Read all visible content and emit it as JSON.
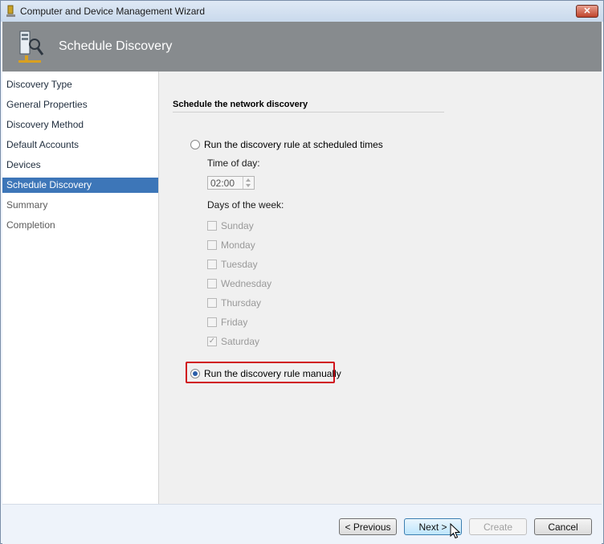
{
  "window": {
    "title": "Computer and Device Management Wizard",
    "close_label": "✕"
  },
  "header": {
    "title": "Schedule Discovery"
  },
  "nav": {
    "items": [
      {
        "label": "Discovery Type"
      },
      {
        "label": "General Properties"
      },
      {
        "label": "Discovery Method"
      },
      {
        "label": "Default Accounts"
      },
      {
        "label": "Devices"
      },
      {
        "label": "Schedule Discovery",
        "selected": true
      },
      {
        "label": "Summary"
      },
      {
        "label": "Completion"
      }
    ]
  },
  "main": {
    "section_title": "Schedule the network discovery",
    "option_scheduled": {
      "label": "Run the discovery rule at scheduled times",
      "selected": false
    },
    "time_of_day_label": "Time of day:",
    "time_value": "02:00",
    "days_label": "Days of the week:",
    "days": [
      {
        "label": "Sunday",
        "checked": false
      },
      {
        "label": "Monday",
        "checked": false
      },
      {
        "label": "Tuesday",
        "checked": false
      },
      {
        "label": "Wednesday",
        "checked": false
      },
      {
        "label": "Thursday",
        "checked": false
      },
      {
        "label": "Friday",
        "checked": false
      },
      {
        "label": "Saturday",
        "checked": true
      }
    ],
    "option_manual": {
      "label": "Run the discovery rule manually",
      "selected": true
    }
  },
  "footer": {
    "previous_label": "< Previous",
    "next_label": "Next >",
    "create_label": "Create",
    "cancel_label": "Cancel"
  },
  "colors": {
    "header_bg": "#878b8e",
    "nav_selected": "#3d76b8",
    "highlight_border": "#d0121b"
  }
}
